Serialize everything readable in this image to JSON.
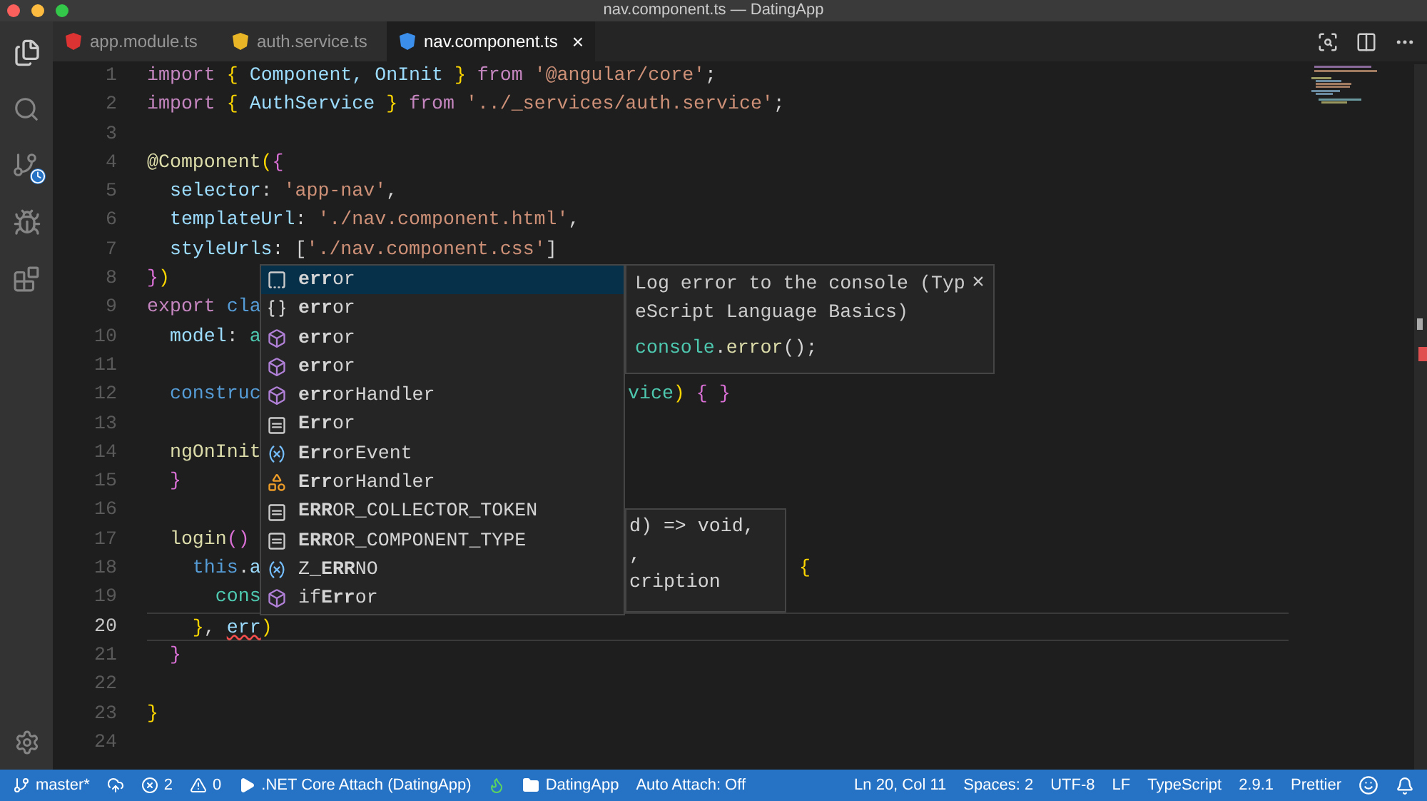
{
  "window": {
    "title": "nav.component.ts — DatingApp"
  },
  "tabs": [
    {
      "label": "app.module.ts",
      "color": "#dd3333",
      "selected": false
    },
    {
      "label": "auth.service.ts",
      "color": "#e8b526",
      "selected": false
    },
    {
      "label": "nav.component.ts",
      "color": "#3b8eea",
      "selected": true,
      "close": "×"
    }
  ],
  "code_lines": [
    {
      "number": "1",
      "selected": false,
      "tokens": [
        {
          "kind": "keyword",
          "text": "import"
        },
        {
          "kind": "brace",
          "text": " {"
        },
        {
          "kind": "ident",
          "text": " Component, OnInit "
        },
        {
          "kind": "brace",
          "text": "}"
        },
        {
          "kind": "keyword",
          "text": " from"
        },
        {
          "kind": "string",
          "text": " '@angular/core'"
        },
        {
          "kind": "plain",
          "text": ";"
        }
      ]
    },
    {
      "number": "2",
      "selected": false,
      "tokens": [
        {
          "kind": "keyword",
          "text": "import"
        },
        {
          "kind": "brace",
          "text": " {"
        },
        {
          "kind": "ident",
          "text": " AuthService "
        },
        {
          "kind": "brace",
          "text": "}"
        },
        {
          "kind": "keyword",
          "text": " from"
        },
        {
          "kind": "string",
          "text": " '../_services/auth.service'"
        },
        {
          "kind": "plain",
          "text": ";"
        }
      ]
    },
    {
      "number": "3",
      "selected": false
    },
    {
      "number": "4",
      "selected": false,
      "tokens": [
        {
          "kind": "decorator",
          "text": "@Component"
        },
        {
          "kind": "brace",
          "text": "("
        },
        {
          "kind": "brace2",
          "text": "{"
        }
      ]
    },
    {
      "number": "5",
      "selected": false,
      "tokens": [
        {
          "kind": "ident",
          "text": "  selector"
        },
        {
          "kind": "plain",
          "text": ": "
        },
        {
          "kind": "string",
          "text": "'app-nav'"
        },
        {
          "kind": "plain",
          "text": ","
        }
      ]
    },
    {
      "number": "6",
      "selected": false,
      "tokens": [
        {
          "kind": "ident",
          "text": "  templateUrl"
        },
        {
          "kind": "plain",
          "text": ": "
        },
        {
          "kind": "string",
          "text": "'./nav.component.html'"
        },
        {
          "kind": "plain",
          "text": ","
        }
      ]
    },
    {
      "number": "7",
      "selected": false,
      "tokens": [
        {
          "kind": "ident",
          "text": "  styleUrls"
        },
        {
          "kind": "plain",
          "text": ": ["
        },
        {
          "kind": "string",
          "text": "'./nav.component.css'"
        },
        {
          "kind": "plain",
          "text": "]"
        }
      ]
    },
    {
      "number": "8",
      "selected": false,
      "tokens": [
        {
          "kind": "brace2",
          "text": "}"
        },
        {
          "kind": "brace",
          "text": ")"
        }
      ]
    },
    {
      "number": "9",
      "selected": false,
      "tokens": [
        {
          "kind": "keyword",
          "text": "export"
        },
        {
          "kind": "storage",
          "text": " cla"
        }
      ]
    },
    {
      "number": "10",
      "selected": false,
      "tokens": [
        {
          "kind": "ident",
          "text": "  model"
        },
        {
          "kind": "plain",
          "text": ": "
        },
        {
          "kind": "type",
          "text": "a"
        }
      ]
    },
    {
      "number": "11",
      "selected": false
    },
    {
      "number": "12",
      "selected": false,
      "tokens": [
        {
          "kind": "storage",
          "text": "  construc"
        }
      ],
      "right": {
        "kind": "after_popup",
        "tokens": [
          {
            "kind": "type",
            "text": "vice"
          },
          {
            "kind": "brace",
            "text": ")"
          },
          {
            "kind": "brace2",
            "text": " { }"
          }
        ]
      }
    },
    {
      "number": "13",
      "selected": false
    },
    {
      "number": "14",
      "selected": false,
      "tokens": [
        {
          "kind": "function",
          "text": "  ngOnInit"
        }
      ]
    },
    {
      "number": "15",
      "selected": false,
      "tokens": [
        {
          "kind": "brace2",
          "text": "  }"
        }
      ]
    },
    {
      "number": "16",
      "selected": false
    },
    {
      "number": "17",
      "selected": false,
      "tokens": [
        {
          "kind": "function",
          "text": "  login"
        },
        {
          "kind": "brace2",
          "text": "()"
        }
      ]
    },
    {
      "number": "18",
      "selected": false,
      "tokens": [
        {
          "kind": "storage",
          "text": "    this"
        },
        {
          "kind": "plain",
          "text": "."
        },
        {
          "kind": "ident",
          "text": "a"
        }
      ],
      "right": {
        "kind": "after_hint",
        "tokens": [
          {
            "kind": "brace",
            "text": "{"
          }
        ]
      }
    },
    {
      "number": "19",
      "selected": false,
      "tokens": [
        {
          "kind": "type",
          "text": "      cons"
        }
      ]
    },
    {
      "number": "20",
      "selected": true,
      "tokens": [
        {
          "kind": "brace",
          "text": "    }"
        },
        {
          "kind": "plain",
          "text": ", "
        },
        {
          "kind": "error",
          "text": "err"
        },
        {
          "kind": "brace",
          "text": ")"
        }
      ]
    },
    {
      "number": "21",
      "selected": false,
      "tokens": [
        {
          "kind": "brace2",
          "text": "  }"
        }
      ]
    },
    {
      "number": "22",
      "selected": false
    },
    {
      "number": "23",
      "selected": false,
      "tokens": [
        {
          "kind": "brace",
          "text": "}"
        }
      ]
    },
    {
      "number": "24",
      "selected": false
    }
  ],
  "suggestions": [
    {
      "kind": "snippet",
      "label": "**err**or",
      "selected": true
    },
    {
      "kind": "keyword",
      "label": "**err**or",
      "selected": false
    },
    {
      "kind": "method",
      "label": "**err**or",
      "selected": false
    },
    {
      "kind": "method",
      "label": "**err**or",
      "selected": false
    },
    {
      "kind": "method",
      "label": "**err**orHandler",
      "selected": false
    },
    {
      "kind": "constant",
      "label": "**Err**or",
      "selected": false
    },
    {
      "kind": "variable",
      "label": "**Err**orEvent",
      "selected": false
    },
    {
      "kind": "class",
      "label": "**Err**orHandler",
      "selected": false
    },
    {
      "kind": "constant",
      "label": "**ERR**OR_COLLECTOR_TOKEN",
      "selected": false
    },
    {
      "kind": "constant",
      "label": "**ERR**OR_COMPONENT_TYPE",
      "selected": false
    },
    {
      "kind": "variable",
      "label": "Z_**ERR**NO",
      "selected": false
    },
    {
      "kind": "method",
      "label": "if**Err**or",
      "selected": false
    }
  ],
  "suggestion_details": {
    "description": "Log error to the console (TypeScript Language Basics)",
    "code": [
      {
        "kind": "type",
        "text": "console"
      },
      {
        "kind": "plain",
        "text": "."
      },
      {
        "kind": "function",
        "text": "error"
      },
      {
        "kind": "plain",
        "text": "();"
      }
    ],
    "close": "×"
  },
  "signature_help": {
    "lines": [
      "d) => void,",
      ",",
      "cription"
    ]
  },
  "status_bar": {
    "left": [
      {
        "kind": "branch",
        "text": "master*"
      },
      {
        "kind": "sync"
      },
      {
        "kind": "errors",
        "text": "2"
      },
      {
        "kind": "warnings",
        "text": "0"
      },
      {
        "kind": "debug",
        "text": ".NET Core Attach (DatingApp)"
      },
      {
        "kind": "flame"
      },
      {
        "kind": "folder",
        "text": "DatingApp"
      },
      {
        "kind": "text",
        "text": "Auto Attach: Off"
      }
    ],
    "right": [
      {
        "kind": "text",
        "text": "Ln 20, Col 11"
      },
      {
        "kind": "text",
        "text": "Spaces: 2"
      },
      {
        "kind": "text",
        "text": "UTF-8"
      },
      {
        "kind": "text",
        "text": "LF"
      },
      {
        "kind": "text",
        "text": "TypeScript"
      },
      {
        "kind": "text",
        "text": "2.9.1"
      },
      {
        "kind": "text",
        "text": "Prettier"
      },
      {
        "kind": "smiley"
      },
      {
        "kind": "bell"
      }
    ]
  }
}
